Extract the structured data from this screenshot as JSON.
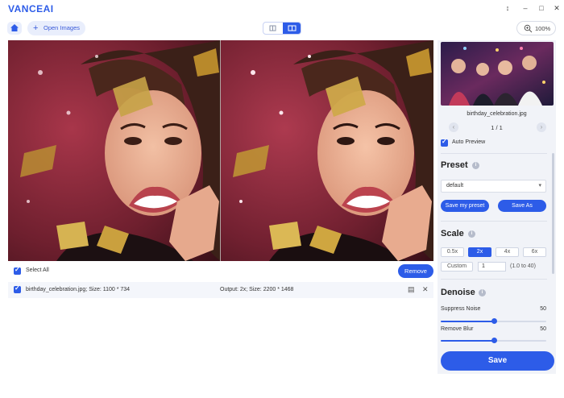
{
  "app": {
    "logo_text": "VANCEAI",
    "window_controls": [
      "pin-icon",
      "minimize-icon",
      "maximize-icon",
      "close-icon"
    ],
    "accent_color": "#2d5ce8"
  },
  "toolbar": {
    "home_icon": "home-icon",
    "open_images_label": "Open Images",
    "view_modes": [
      "single-view",
      "split-view"
    ],
    "active_view": "split-view",
    "zoom_label": "100%"
  },
  "file_list": {
    "select_all_label": "Select All",
    "remove_label": "Remove",
    "rows": [
      {
        "name_info": "birthday_celebration.jpg; Size: 1100 * 734",
        "output_info": "Output: 2x; Size: 2200 * 1468",
        "checked": true
      }
    ]
  },
  "sidebar": {
    "thumb_name": "birthday_celebration.jpg",
    "pager": "1 / 1",
    "auto_preview_label": "Auto Preview",
    "auto_preview_checked": true,
    "preset": {
      "title": "Preset",
      "selected": "default",
      "save_my_preset": "Save my preset",
      "save_as": "Save As"
    },
    "scale": {
      "title": "Scale",
      "options": [
        "0.5x",
        "2x",
        "4x",
        "6x"
      ],
      "selected": "2x",
      "custom_label": "Custom",
      "custom_value": "1",
      "custom_range": "(1.0 to 40)"
    },
    "denoise": {
      "title": "Denoise",
      "suppress_noise_label": "Suppress Noise",
      "suppress_noise_value": "50",
      "suppress_noise_fraction": 0.5,
      "remove_blur_label": "Remove Blur",
      "remove_blur_value": "50",
      "remove_blur_fraction": 0.5
    },
    "save_label": "Save"
  }
}
